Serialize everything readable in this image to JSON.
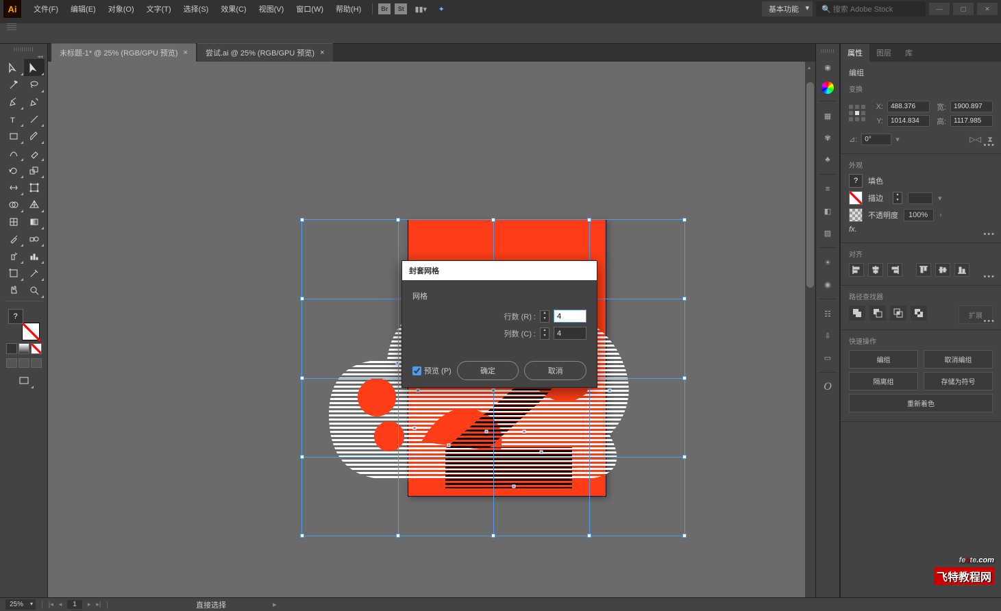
{
  "app": {
    "logo": "Ai"
  },
  "menu": [
    "文件(F)",
    "编辑(E)",
    "对象(O)",
    "文字(T)",
    "选择(S)",
    "效果(C)",
    "视图(V)",
    "窗口(W)",
    "帮助(H)"
  ],
  "titlebar": {
    "workspace": "基本功能",
    "search_placeholder": "搜索 Adobe Stock"
  },
  "tabs": [
    {
      "label": "未标题-1* @ 25% (RGB/GPU 预览)",
      "active": true
    },
    {
      "label": "尝试.ai @ 25% (RGB/GPU 预览)",
      "active": false
    }
  ],
  "dialog": {
    "title": "封套网格",
    "group": "网格",
    "rows_label": "行数 (R) :",
    "rows_value": "4",
    "cols_label": "列数 (C) :",
    "cols_value": "4",
    "preview": "预览 (P)",
    "ok": "确定",
    "cancel": "取消"
  },
  "panels": {
    "tabs": [
      "属性",
      "图层",
      "库"
    ],
    "group": "编组",
    "transform": {
      "title": "变换",
      "x": "488.376",
      "y": "1014.834",
      "w": "1900.897",
      "h": "1117.985",
      "angle": "0°",
      "x_lbl": "X:",
      "y_lbl": "Y:",
      "w_lbl": "宽:",
      "h_lbl": "高:"
    },
    "appearance": {
      "title": "外观",
      "fill": "填色",
      "stroke": "描边",
      "opacity": "不透明度",
      "opacity_val": "100%",
      "fx": "fx."
    },
    "align": {
      "title": "对齐"
    },
    "pathfinder": {
      "title": "路径查找器",
      "expand": "扩展"
    },
    "quick": {
      "title": "快速操作",
      "group": "编组",
      "ungroup": "取消编组",
      "isolate": "隔离组",
      "save_symbol": "存储为符号",
      "recolor": "重新着色"
    }
  },
  "status": {
    "zoom": "25%",
    "page": "1",
    "tool": "直接选择"
  },
  "watermark": {
    "l1a": "fe",
    "l1b": "v",
    "l1c": "te",
    "l1d": ".com",
    "l2": "飞特教程网"
  }
}
